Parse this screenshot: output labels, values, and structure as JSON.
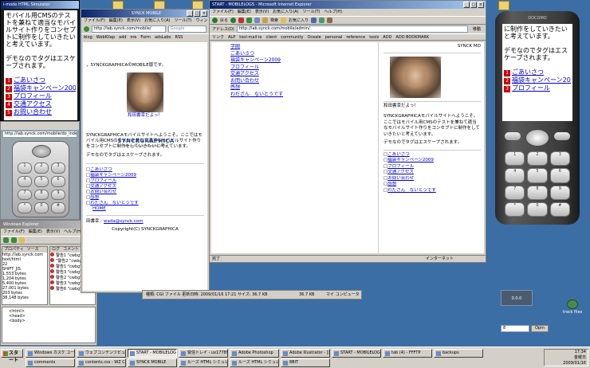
{
  "desktop": {
    "icons_left": [
      "",
      "",
      ""
    ],
    "icons_right": [
      "",
      "track files"
    ],
    "gadget_label": "0.0.0"
  },
  "phone_left": {
    "title": "i-mode HTML Simulator",
    "text": "モバイル用CMSのテストを兼ねて適当なモバイルサイト作りをコンセプトに制作をしていきたいと考えています。",
    "text2": "デモなのでタグはエスケープされます。",
    "links": [
      "ごあいさつ",
      "福袋キャンペーン2009",
      "プロフィール",
      "交通アクセス",
      "お問い合わせ"
    ]
  },
  "sim_window": {
    "url": "http://lab.synck.com/mobile/do_inde"
  },
  "explorer": {
    "title": "Windows Explorer",
    "menu": [
      "ファイル(F)",
      "編集(E)",
      "表示(V)",
      "ヘルプ(H)"
    ],
    "col_headers": [
      "プロパティ",
      "ソース",
      "",
      "ログ",
      "コメント"
    ],
    "rows": [
      {
        "name": "http://lab.synck.com",
        "size": ""
      },
      {
        "name": "text/html",
        "size": ""
      },
      {
        "name": "22",
        "size": ""
      },
      {
        "name": "SHIFT_JIS",
        "size": ""
      },
      {
        "name": "1,553 bytes",
        "size": ""
      },
      {
        "name": "1,204 bytes",
        "size": ""
      },
      {
        "name": "5,400 bytes",
        "size": ""
      },
      {
        "name": "27,001 bytes",
        "size": ""
      },
      {
        "name": "203 bytes",
        "size": ""
      },
      {
        "name": "38,148 bytes",
        "size": ""
      }
    ],
    "log_rows": [
      "警告1 \"cwbg\"",
      "\"警告2 \"cwbg\"",
      "警告1 \"cwbg\"",
      "警告3 \"cwbg\"",
      "警告2 \"cwbg\"",
      "警告3 \"cwbg\"",
      "警告6 \"cwbg\""
    ],
    "tree": [
      "<html>",
      "<head>",
      "<body>"
    ]
  },
  "synck_window": {
    "title": "SYNCK MOBILE",
    "menu": [
      "ファイル(F)",
      "編集(E)",
      "表示(V)",
      "お気に入り(A)",
      "ツール(T)",
      "ウィンドウ(W)",
      "ヘルプ(H)"
    ],
    "url": "http://lab.synck.com/mobile/",
    "search_placeholder": "Google",
    "bookmarks": [
      "blog",
      "WebKilap",
      "add",
      "me",
      "Form",
      "adsLabs",
      "RSS"
    ],
    "intro": "，SYNCKGRAPHICAのMOBILE版です。",
    "logo": "SYNCKGRAPHICA",
    "logo_sub": "WEB DESIGN & CONSULTANT OFFICE",
    "caption": "和田書幸だよっ！",
    "body1": "SYNCKGRAPHICAモバイルサイトへようこそ。ここではモバイル用CMSのテストを兼ねて適当なモバイルサイト作りをコンセプトに制作をしていきたいと考えています。",
    "body2": "デモなのでタグはエスケープされます。",
    "links": [
      "ごあいさつ",
      "福袋キャンペーン2009",
      "プロフィール",
      "交通アクセス",
      "お問い合わせ",
      "感想",
      "わだざん　ないとうです"
    ],
    "home": "HOME",
    "footer_label": "田書幸／",
    "footer_email": "wada@synck.com",
    "copyright": "Copyright(C) SYNCKGRAPHICA"
  },
  "ie_window": {
    "title": "START - MOBILELOGS - Microsoft Internet Explorer",
    "menu": [
      "ファイル(F)",
      "編集(E)",
      "表示(V)",
      "お気に入り(A)",
      "ツール(T)",
      "ヘルプ(H)"
    ],
    "back": "戻る",
    "search": "検索",
    "favorites": "お気に入り",
    "address_label": "アドレス(D)",
    "url": "http://lab.synck.com/mobile/admin/",
    "go": "移動",
    "links_label": "リンク",
    "bookmarks": [
      "ALP",
      "tool-mail-ie",
      "client",
      "community",
      "Oceale",
      "personal",
      "reference",
      "tools",
      "ADD",
      "ADD BOOKMARK"
    ],
    "top_links": [
      "学閥",
      "ごあいさつ",
      "福袋キャンペーン2009",
      "プロフィール",
      "交通アクセス",
      "お問い合わせ",
      "感想",
      "わだざん　ないとうです"
    ],
    "side_title": "SYNCK MO",
    "side_caption": "和田書幸だよっ！",
    "side_body1": "SYNCKGRAPHICAモバイルサイトへようこそ。ここではモバイル用CMSのテストを兼ねて適当なモバイルサイト作りをコンセプトに制作をしていきたいと考えています。",
    "side_body2": "デモなのでタグはエスケープされます。",
    "side_links": [
      "ごあいさつ",
      "福袋キャンペーン2009",
      "プロフィール",
      "交通アクセス",
      "お問い合わせ",
      "感想",
      "わだざん　ないとうです"
    ],
    "status_left": "完了",
    "status_right": "インターネット"
  },
  "status_strip": {
    "text": "種類: CGI ファイル   更新日時: 2009/01/16 17:21  サイズ: 36.7 KB",
    "size": "36.7 KB",
    "place": "マイ コンピュータ"
  },
  "phone_right": {
    "text": "に制作をしていきたいと考えています。",
    "text2": "デモなのでタグはエスケープされます。",
    "links": [
      "ごあいさつ",
      "福袋キャンペーン2009",
      "プロフィール"
    ],
    "brand": "DOCOMO"
  },
  "mini_bar": {
    "value": "8",
    "label": "Opm"
  },
  "taskbar": {
    "start": "スタート",
    "row1": [
      "Windows カスケ ユーティリ",
      "ウェブコンテンツビューアー - E",
      "START - MOBILELOGS",
      "受信トレイ - ux177890tin",
      "Adobe Photoshop",
      "Adobe Illustrator - [注",
      "START - MOBILELOGS",
      "tab (4) - FFFTP",
      "backups"
    ],
    "row2": [
      "comments",
      "contents.css - WZ C PX",
      "SYNCK MOBILE",
      "ルーズ HTML シミュレータ",
      "ルーズ HTML シミュレータ",
      "8BIT"
    ],
    "time": "17:34",
    "day": "金曜日",
    "date": "2009/01/16"
  },
  "colors": {
    "desktop": "#3a6ea5",
    "titlebar": "#0a246a",
    "link": "#0000cc",
    "accent_red": "#cc0000"
  }
}
